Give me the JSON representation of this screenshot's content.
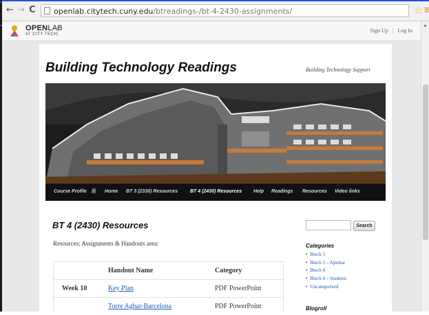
{
  "browser": {
    "url_host": "openlab.citytech.cuny.edu",
    "url_path": "/btreadings-/bt-4-2430-assignments/"
  },
  "adminbar": {
    "logo_bold": "OPEN",
    "logo_light": "LAB",
    "logo_sub": "AT CITY TECH",
    "signup": "Sign Up",
    "login": "Log In"
  },
  "site": {
    "title": "Building Technology Readings",
    "description": "Building Technology Support"
  },
  "nav": {
    "items": [
      "Course Profile",
      "Home",
      "BT 3 (2330) Resources",
      "BT 4 (2430) Resources",
      "Help",
      "Readings",
      "Resources",
      "Video links"
    ],
    "active": "BT 4 (2430) Resources"
  },
  "page": {
    "heading": "BT 4 (2430) Resources",
    "intro": "Resources; Assignments & Handouts area:"
  },
  "table": {
    "headers": [
      "",
      "Handout Name",
      "Category"
    ],
    "rows": [
      [
        "Week 10",
        "Key Plan",
        "PDF PowerPoint"
      ],
      [
        "",
        "Torre Agbar-Barcelona",
        "PDF PowerPoint"
      ]
    ]
  },
  "sidebar": {
    "search_placeholder": "",
    "search_button": "Search",
    "categories_heading": "Categories",
    "categories": [
      "Btech 3",
      "Btech 3 – Aptekar",
      "Btech 4",
      "Btech 4 – Students",
      "Uncategorized"
    ],
    "blogroll_heading": "Blogroll"
  },
  "colors": {
    "link": "#1f5bb5",
    "nav_bg": "#111111",
    "page_bg": "#e8e8e8"
  }
}
